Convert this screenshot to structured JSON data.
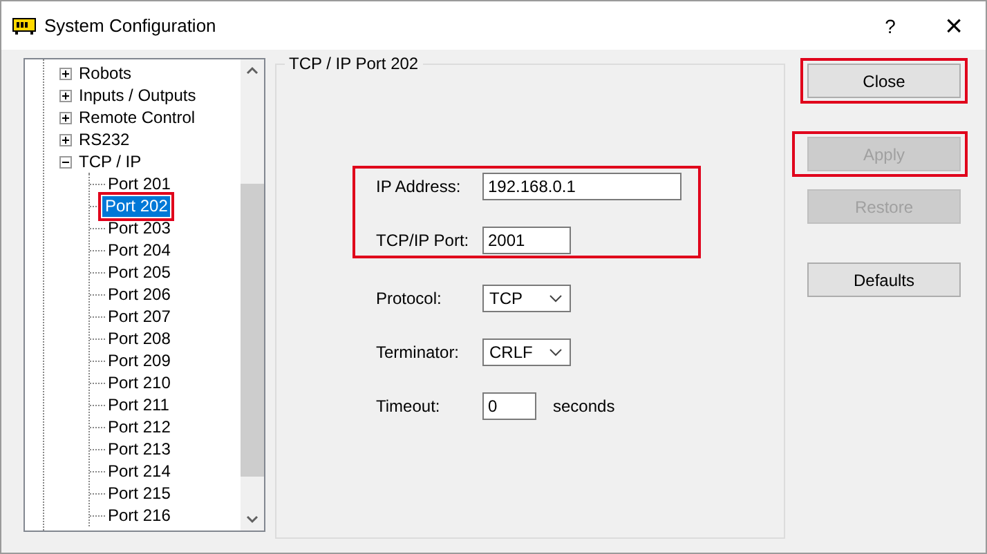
{
  "window": {
    "title": "System Configuration",
    "help": "?",
    "close": "×"
  },
  "tree": [
    {
      "label": "Robots",
      "expanded": false
    },
    {
      "label": "Inputs / Outputs",
      "expanded": false
    },
    {
      "label": "Remote Control",
      "expanded": false
    },
    {
      "label": "RS232",
      "expanded": false
    },
    {
      "label": "TCP / IP",
      "expanded": true,
      "children": [
        {
          "label": "Port 201",
          "selected": false,
          "highlighted": false
        },
        {
          "label": "Port 202",
          "selected": true,
          "highlighted": true
        },
        {
          "label": "Port 203",
          "selected": false,
          "highlighted": false
        },
        {
          "label": "Port 204",
          "selected": false,
          "highlighted": false
        },
        {
          "label": "Port 205",
          "selected": false,
          "highlighted": false
        },
        {
          "label": "Port 206",
          "selected": false,
          "highlighted": false
        },
        {
          "label": "Port 207",
          "selected": false,
          "highlighted": false
        },
        {
          "label": "Port 208",
          "selected": false,
          "highlighted": false
        },
        {
          "label": "Port 209",
          "selected": false,
          "highlighted": false
        },
        {
          "label": "Port 210",
          "selected": false,
          "highlighted": false
        },
        {
          "label": "Port 211",
          "selected": false,
          "highlighted": false
        },
        {
          "label": "Port 212",
          "selected": false,
          "highlighted": false
        },
        {
          "label": "Port 213",
          "selected": false,
          "highlighted": false
        },
        {
          "label": "Port 214",
          "selected": false,
          "highlighted": false
        },
        {
          "label": "Port 215",
          "selected": false,
          "highlighted": false
        },
        {
          "label": "Port 216",
          "selected": false,
          "highlighted": false
        }
      ]
    }
  ],
  "group": {
    "title": "TCP / IP Port 202",
    "field_groups": [
      {
        "highlighted": true,
        "fields": [
          {
            "kind": "text",
            "label": "IP Address:",
            "value": "192.168.0.1"
          },
          {
            "kind": "short",
            "label": "TCP/IP Port:",
            "value": "2001"
          }
        ]
      },
      {
        "highlighted": false,
        "fields": [
          {
            "kind": "dropdown",
            "label": "Protocol:",
            "value": "TCP"
          },
          {
            "kind": "dropdown",
            "label": "Terminator:",
            "value": "CRLF"
          },
          {
            "kind": "number",
            "label": "Timeout:",
            "value": "0",
            "unit": "seconds"
          }
        ]
      }
    ]
  },
  "buttons": [
    {
      "label": "Close",
      "disabled": false,
      "highlighted": true
    },
    {
      "label": "Apply",
      "disabled": true,
      "highlighted": true
    },
    {
      "label": "Restore",
      "disabled": true,
      "highlighted": false
    },
    {
      "label": "Defaults",
      "disabled": false,
      "highlighted": false
    }
  ]
}
